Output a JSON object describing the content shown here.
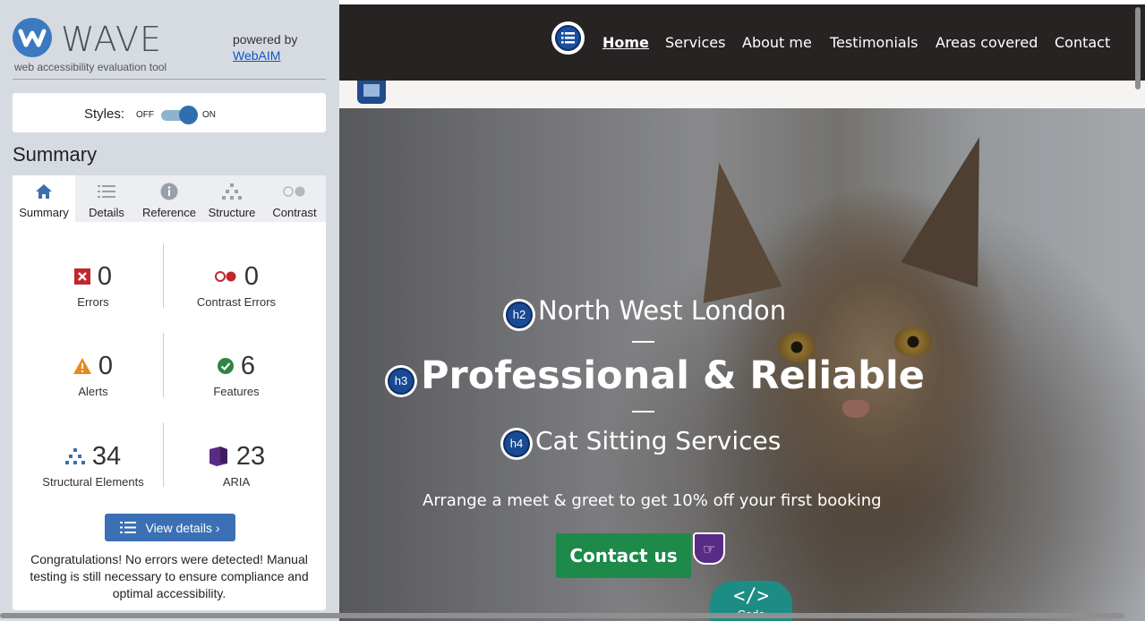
{
  "wave": {
    "logo_text": "WAVE",
    "subtitle": "web accessibility evaluation tool",
    "powered_by": "powered by",
    "webaim_link": "WebAIM",
    "styles_label": "Styles:",
    "styles_off": "OFF",
    "styles_on": "ON",
    "styles_enabled": true,
    "summary_heading": "Summary",
    "tabs": [
      {
        "label": "Summary",
        "icon": "home-icon",
        "active": true
      },
      {
        "label": "Details",
        "icon": "list-icon",
        "active": false
      },
      {
        "label": "Reference",
        "icon": "info-icon",
        "active": false
      },
      {
        "label": "Structure",
        "icon": "structure-icon",
        "active": false
      },
      {
        "label": "Contrast",
        "icon": "contrast-icon",
        "active": false
      }
    ],
    "stats": {
      "errors": {
        "value": "0",
        "label": "Errors",
        "icon": "error-icon",
        "color": "#c0272d"
      },
      "contrast_errors": {
        "value": "0",
        "label": "Contrast Errors",
        "icon": "contrast-error-icon",
        "color": "#c0272d"
      },
      "alerts": {
        "value": "0",
        "label": "Alerts",
        "icon": "alert-icon",
        "color": "#e58a1f"
      },
      "features": {
        "value": "6",
        "label": "Features",
        "icon": "feature-icon",
        "color": "#2e8540"
      },
      "structural": {
        "value": "34",
        "label": "Structural Elements",
        "icon": "structure-icon",
        "color": "#3b6fae"
      },
      "aria": {
        "value": "23",
        "label": "ARIA",
        "icon": "aria-icon",
        "color": "#5a2b86"
      }
    },
    "view_details_label": "View details ›",
    "congrats": "Congratulations! No errors were detected! Manual testing is still necessary to ensure compliance and optimal accessibility."
  },
  "site": {
    "nav": [
      "Home",
      "Services",
      "About me",
      "Testimonials",
      "Areas covered",
      "Contact"
    ],
    "active_nav": "Home",
    "hero": {
      "h2": "North West London",
      "h3": "Professional & Reliable",
      "h4": "Cat Sitting Services",
      "h2_badge": "h2",
      "h3_badge": "h3",
      "h4_badge": "h4",
      "paragraph": "Arrange a meet & greet to get 10% off your first booking",
      "cta": "Contact us"
    },
    "code_tab": {
      "icon": "</>",
      "label": "Code"
    },
    "colors": {
      "topbar": "#262322",
      "cta": "#1d8a4a",
      "code_tab": "#1d8c84"
    }
  }
}
